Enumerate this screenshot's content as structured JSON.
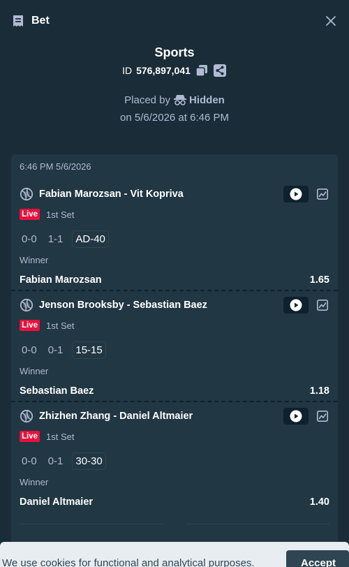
{
  "header": {
    "title": "Bet"
  },
  "summary": {
    "sport": "Sports",
    "id_prefix": "ID",
    "id_value": "576,897,041",
    "placed_by_label": "Placed by",
    "placed_by_user": "Hidden",
    "placed_on": "on 5/6/2026 at 6:46 PM"
  },
  "card": {
    "timestamp": "6:46 PM 5/6/2026",
    "legs": [
      {
        "match": "Fabian Marozsan - Vit Kopriva",
        "status": "Live",
        "period": "1st Set",
        "scores": [
          "0-0",
          "1-1"
        ],
        "current_score": "AD-40",
        "market": "Winner",
        "selection": "Fabian Marozsan",
        "odds": "1.65"
      },
      {
        "match": "Jenson Brooksby - Sebastian Baez",
        "status": "Live",
        "period": "1st Set",
        "scores": [
          "0-0",
          "0-1"
        ],
        "current_score": "15-15",
        "market": "Winner",
        "selection": "Sebastian Baez",
        "odds": "1.18"
      },
      {
        "match": "Zhizhen Zhang - Daniel Altmaier",
        "status": "Live",
        "period": "1st Set",
        "scores": [
          "0-0",
          "0-1"
        ],
        "current_score": "30-30",
        "market": "Winner",
        "selection": "Daniel Altmaier",
        "odds": "1.40"
      }
    ]
  },
  "cookie": {
    "text": "We use cookies for functional and analytical purposes.",
    "accept_label": "Accept"
  },
  "colors": {
    "background": "#1a2c38",
    "card": "#213743",
    "live": "#e9113c",
    "accent": "#1475e1"
  }
}
